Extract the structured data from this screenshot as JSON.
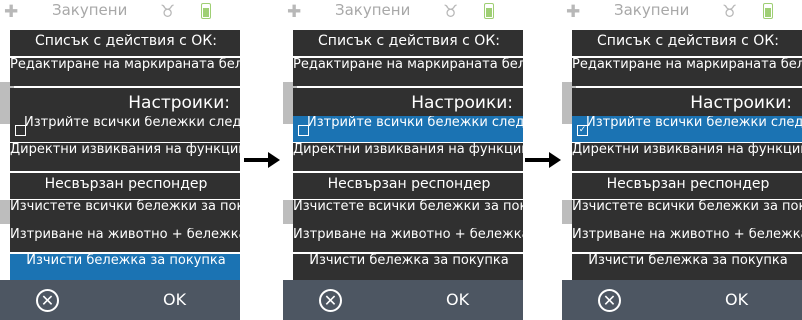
{
  "topbar": {
    "title": "Закупени"
  },
  "menu": {
    "items": [
      "Списък с действия с ОК:",
      "Редактиране на маркираната бележка",
      "Настроики:",
      "Изтрийте всички бележки след експортиране",
      "Директни извиквания на функции:",
      "Несвързан респондер",
      "Изчистете всички бележки за покупка",
      "Изтриване на животно + бележка",
      "Изчисти бележка  за покупка"
    ]
  },
  "bottombar": {
    "ok_label": "OK"
  },
  "colors": {
    "menu_bg": "#303030",
    "highlight": "#1b73b3",
    "bottombar": "#4d5662"
  },
  "checkbox_states": {
    "panel1": false,
    "panel2": false,
    "panel3": true
  },
  "check_mark": "✓"
}
